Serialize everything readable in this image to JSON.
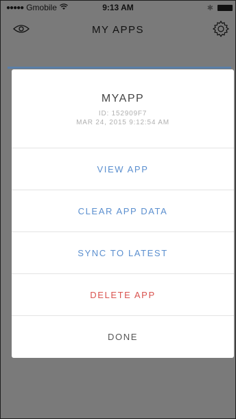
{
  "status": {
    "carrier": "Gmobile",
    "time": "9:13 AM"
  },
  "nav": {
    "title": "MY APPS",
    "left_icon": "eye-icon",
    "right_icon": "gear-icon"
  },
  "sheet": {
    "app_name": "MYAPP",
    "app_id": "ID: 152909F7",
    "app_date": "MAR 24, 2015 9:12:54 AM",
    "actions": [
      {
        "label": "VIEW APP",
        "color": "#5b8fcf"
      },
      {
        "label": "CLEAR APP DATA",
        "color": "#5b8fcf"
      },
      {
        "label": "SYNC TO LATEST",
        "color": "#5b8fcf"
      },
      {
        "label": "DELETE APP",
        "color": "#d9534f"
      },
      {
        "label": "DONE",
        "color": "#555555"
      }
    ]
  }
}
